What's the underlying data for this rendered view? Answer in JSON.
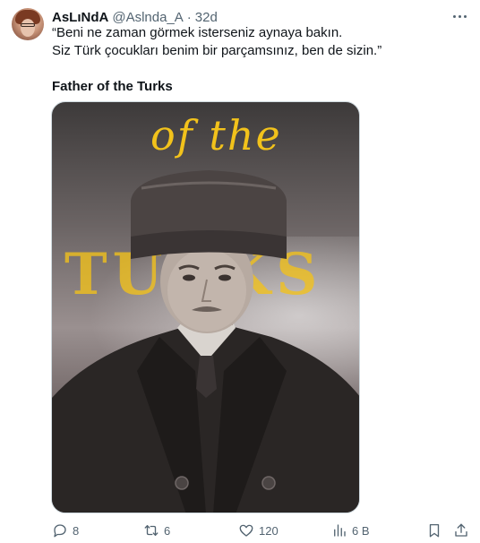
{
  "tweet": {
    "author": {
      "display_name": "AsLıNdA",
      "handle": "@Aslnda_A",
      "separator": "·",
      "time": "32d",
      "avatar_icon": "user-avatar"
    },
    "text_lines": [
      "“Beni ne zaman görmek isterseniz aynaya bakın.",
      "Siz Türk çocukları benim bir parçamsınız, ben de sizin.”"
    ],
    "subtitle": "Father of the Turks",
    "media": {
      "script_text": "of the",
      "big_text": "TURKS",
      "accent_color": "#f2c21b"
    },
    "actions": {
      "replies": "8",
      "reposts": "6",
      "likes": "120",
      "views": "6 B"
    },
    "icons": [
      "more-icon",
      "reply-icon",
      "repost-icon",
      "like-icon",
      "views-icon",
      "bookmark-icon",
      "share-icon"
    ]
  }
}
